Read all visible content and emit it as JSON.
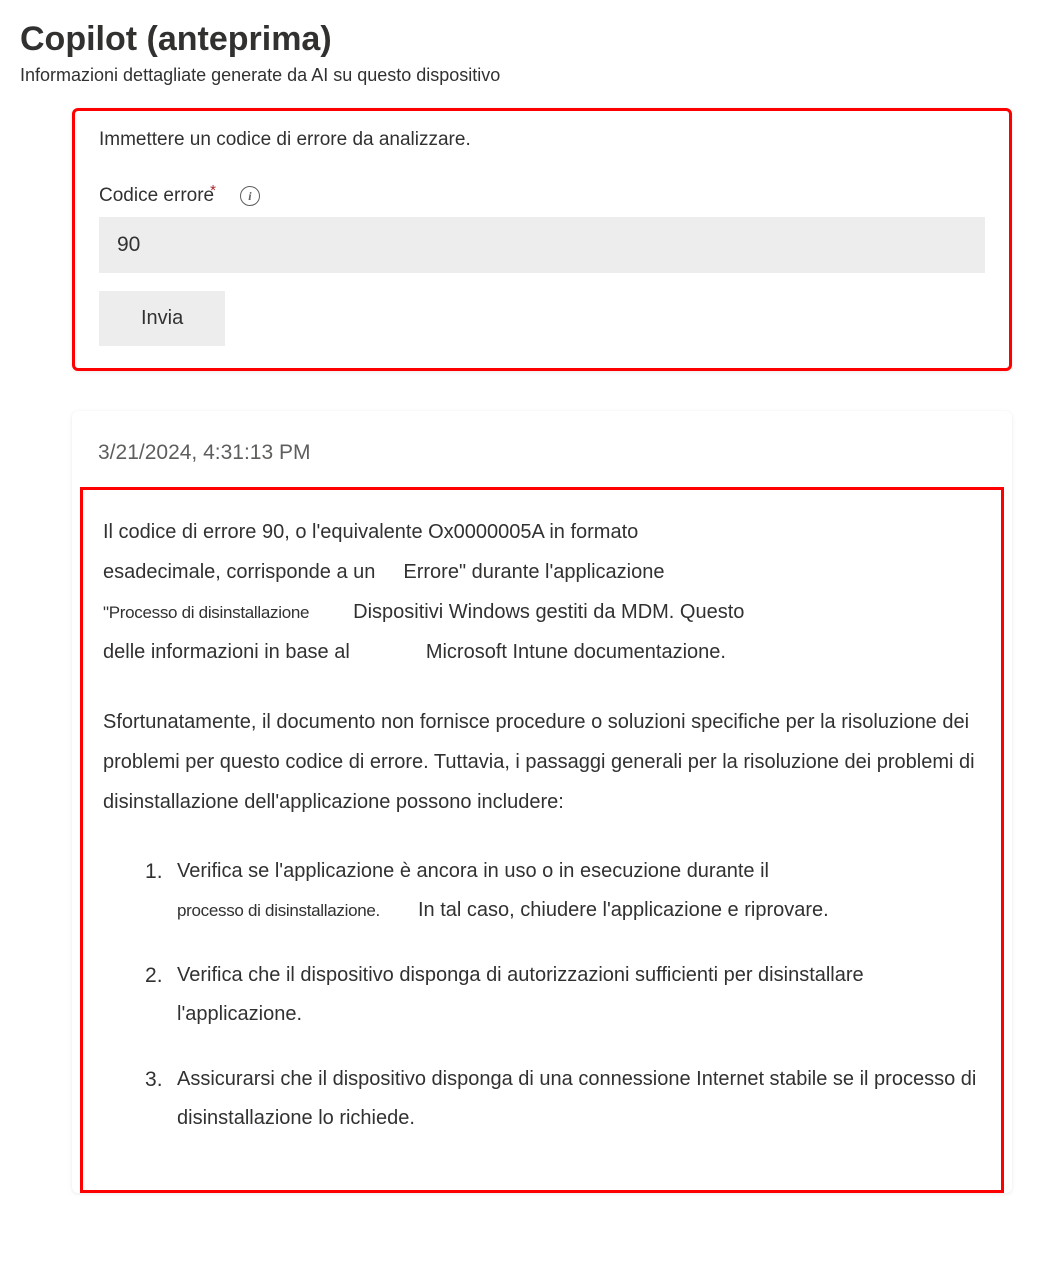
{
  "header": {
    "title": "Copilot (anteprima)",
    "subtitle": "Informazioni dettagliate generate da AI su questo dispositivo"
  },
  "input_panel": {
    "instruction": "Immettere un codice di errore da analizzare.",
    "field_label": "Codice errore",
    "required_mark": "*",
    "info_glyph": "i",
    "value": "90",
    "submit_label": "Invia"
  },
  "response": {
    "timestamp": "3/21/2024, 4:31:13 PM",
    "p1": {
      "l1": "Il codice di errore 90, o l'equivalente Ox0000005A in formato",
      "l2a": "esadecimale, corrisponde a un",
      "l2b": "Errore\" durante l'applicazione",
      "l3a": "\"Processo di disinstallazione",
      "l3b": "Dispositivi Windows gestiti da MDM. Questo",
      "l4a": "delle informazioni in base al",
      "l4b": "Microsoft Intune documentazione."
    },
    "p2": "Sfortunatamente, il documento non fornisce procedure o soluzioni specifiche per la risoluzione dei problemi per questo codice di errore. Tuttavia, i passaggi generali per la risoluzione dei problemi di disinstallazione dell'applicazione possono includere:",
    "steps": {
      "s1a": "Verifica se l'applicazione è ancora in uso o in esecuzione durante il",
      "s1b": "processo di disinstallazione.",
      "s1c": "In tal caso, chiudere l'applicazione e riprovare.",
      "s2": "Verifica che il dispositivo disponga di autorizzazioni sufficienti per disinstallare l'applicazione.",
      "s3": "Assicurarsi che il dispositivo disponga di una connessione Internet stabile se il processo di disinstallazione lo richiede."
    }
  }
}
